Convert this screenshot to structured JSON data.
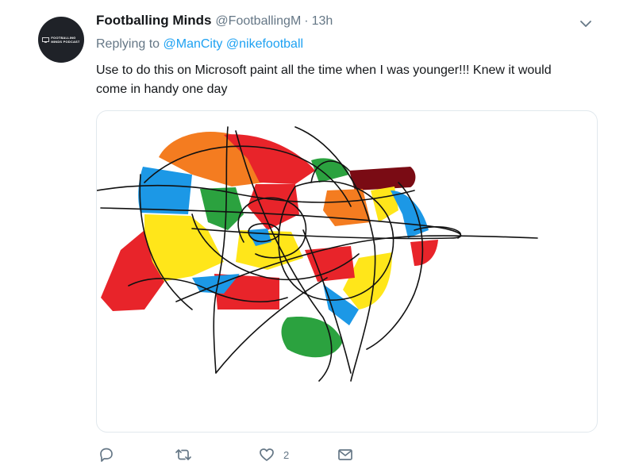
{
  "tweet": {
    "name": "Footballing Minds",
    "handle": "@FootballingM",
    "separator": "·",
    "time": "13h",
    "replying_prefix": "Replying to",
    "replying_to": [
      "@ManCity",
      "@nikefootball"
    ],
    "text": "Use to do this on Microsoft paint all the time when I was younger!!! Knew it would come in handy one day",
    "avatar_text_line1": "FOOTBALLING",
    "avatar_text_line2": "MINDS PODCAST",
    "likes": "2",
    "icons": {
      "caret": "chevron-down-icon",
      "reply": "reply-icon",
      "retweet": "retweet-icon",
      "like": "heart-icon",
      "message": "envelope-icon"
    },
    "colors": {
      "name": "#14171a",
      "secondary": "#657786",
      "link": "#1da1f2",
      "media_border": "#e1e8ed",
      "paint_red": "#e8242a",
      "paint_orange": "#f47c20",
      "paint_yellow": "#ffe61a",
      "paint_blue": "#1c98e6",
      "paint_green": "#2ba23f",
      "paint_maroon": "#7a0b14"
    }
  }
}
